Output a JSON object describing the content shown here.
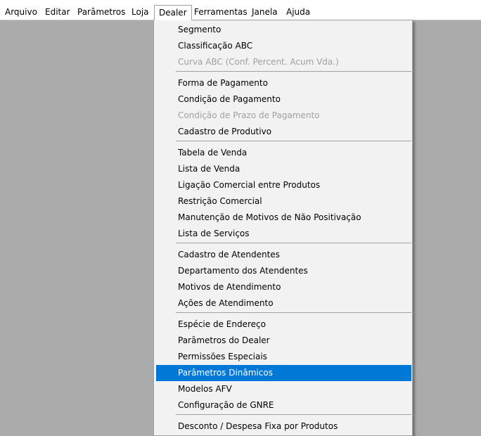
{
  "menubar": [
    {
      "label": "Arquivo"
    },
    {
      "label": "Editar"
    },
    {
      "label": "Parâmetros"
    },
    {
      "label": "Loja"
    },
    {
      "label": "Dealer"
    },
    {
      "label": "Ferramentas"
    },
    {
      "label": "Janela"
    },
    {
      "label": "Ajuda"
    }
  ],
  "dealer_menu": [
    {
      "label": "Segmento"
    },
    {
      "label": "Classificação ABC"
    },
    {
      "label": "Curva ABC (Conf. Percent. Acum Vda.)"
    },
    {
      "label": "Forma de Pagamento"
    },
    {
      "label": "Condição de Pagamento"
    },
    {
      "label": "Condição de Prazo de Pagamento"
    },
    {
      "label": "Cadastro de Produtivo"
    },
    {
      "label": "Tabela de Venda"
    },
    {
      "label": "Lista de Venda"
    },
    {
      "label": "Ligação Comercial entre Produtos"
    },
    {
      "label": "Restrição Comercial"
    },
    {
      "label": "Manutenção de Motivos de Não Positivação"
    },
    {
      "label": "Lista de Serviços"
    },
    {
      "label": "Cadastro de Atendentes"
    },
    {
      "label": "Departamento dos Atendentes"
    },
    {
      "label": "Motivos de Atendimento"
    },
    {
      "label": "Ações de Atendimento"
    },
    {
      "label": "Espécie de Endereço"
    },
    {
      "label": "Parâmetros do Dealer"
    },
    {
      "label": "Permissões Especiais"
    },
    {
      "label": "Parâmetros Dinâmicos"
    },
    {
      "label": "Modelos AFV"
    },
    {
      "label": "Configuração de GNRE"
    },
    {
      "label": "Desconto / Despesa Fixa por Produtos"
    }
  ],
  "colors": {
    "highlight": "#0078d7",
    "disabled_text": "#a0a0a0",
    "workspace": "#ababab",
    "menu_background": "#f2f2f2"
  }
}
